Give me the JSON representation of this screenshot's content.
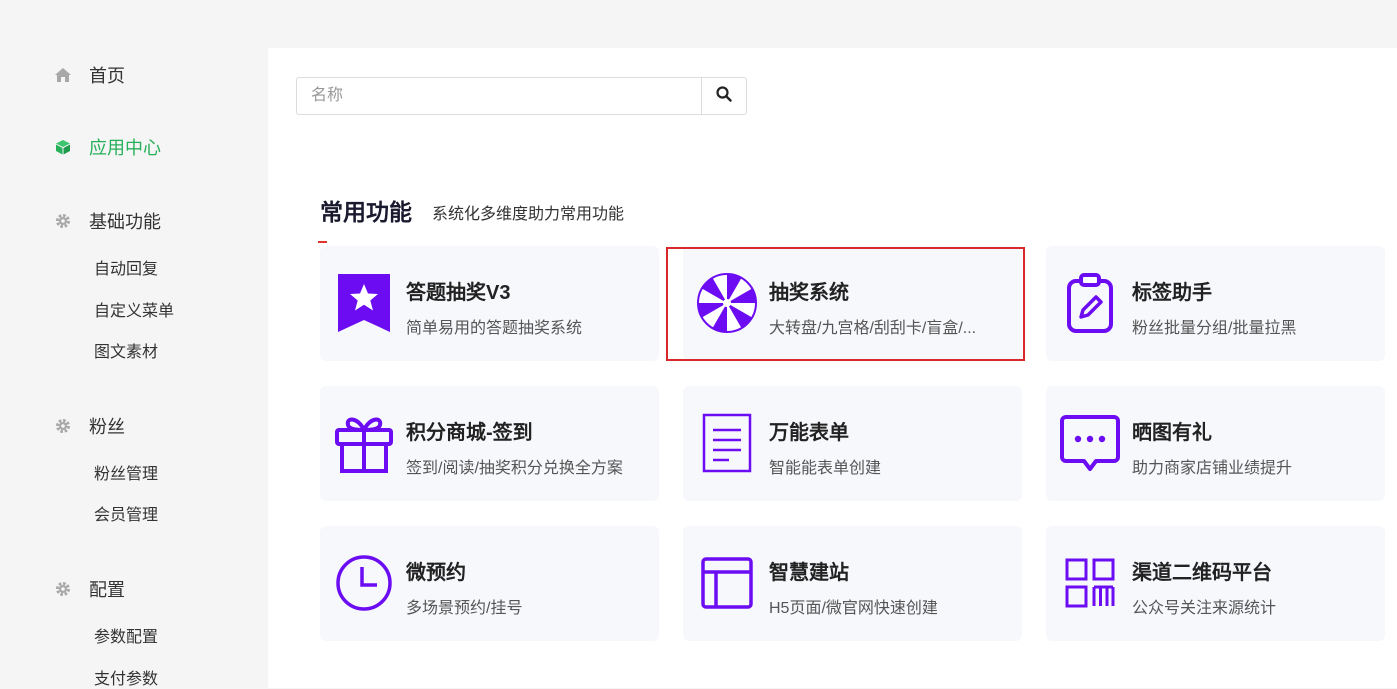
{
  "sidebar": {
    "home": {
      "label": "首页",
      "icon": "home-icon"
    },
    "app_center": {
      "label": "应用中心",
      "icon": "cube-icon",
      "active_color": "#27b05a"
    },
    "basic": {
      "label": "基础功能",
      "icon": "gear-icon",
      "items": [
        "自动回复",
        "自定义菜单",
        "图文素材"
      ]
    },
    "fans": {
      "label": "粉丝",
      "icon": "gear-icon",
      "items": [
        "粉丝管理",
        "会员管理"
      ]
    },
    "config": {
      "label": "配置",
      "icon": "gear-icon",
      "items": [
        "参数配置",
        "支付参数"
      ]
    }
  },
  "search": {
    "placeholder": "名称",
    "icon": "search-icon"
  },
  "section": {
    "title": "常用功能",
    "subtitle": "系统化多维度助力常用功能",
    "accent": "#e0352b"
  },
  "cards": [
    {
      "title": "答题抽奖V3",
      "desc": "简单易用的答题抽奖系统",
      "icon": "ribbon-star-icon"
    },
    {
      "title": "抽奖系统",
      "desc": "大转盘/九宫格/刮刮卡/盲盒/...",
      "icon": "wheel-icon"
    },
    {
      "title": "标签助手",
      "desc": "粉丝批量分组/批量拉黑",
      "icon": "tag-clipboard-icon"
    },
    {
      "title": "积分商城-签到",
      "desc": "签到/阅读/抽奖积分兑换全方案",
      "icon": "gift-icon"
    },
    {
      "title": "万能表单",
      "desc": "智能能表单创建",
      "icon": "form-icon"
    },
    {
      "title": "晒图有礼",
      "desc": "助力商家店铺业绩提升",
      "icon": "chat-dots-icon"
    },
    {
      "title": "微预约",
      "desc": "多场景预约/挂号",
      "icon": "clock-icon"
    },
    {
      "title": "智慧建站",
      "desc": "H5页面/微官网快速创建",
      "icon": "layout-icon"
    },
    {
      "title": "渠道二维码平台",
      "desc": "公众号关注来源统计",
      "icon": "qrcode-icon"
    }
  ],
  "colors": {
    "brand_purple": "#6b0cf3",
    "highlight_border": "#d9272e"
  }
}
